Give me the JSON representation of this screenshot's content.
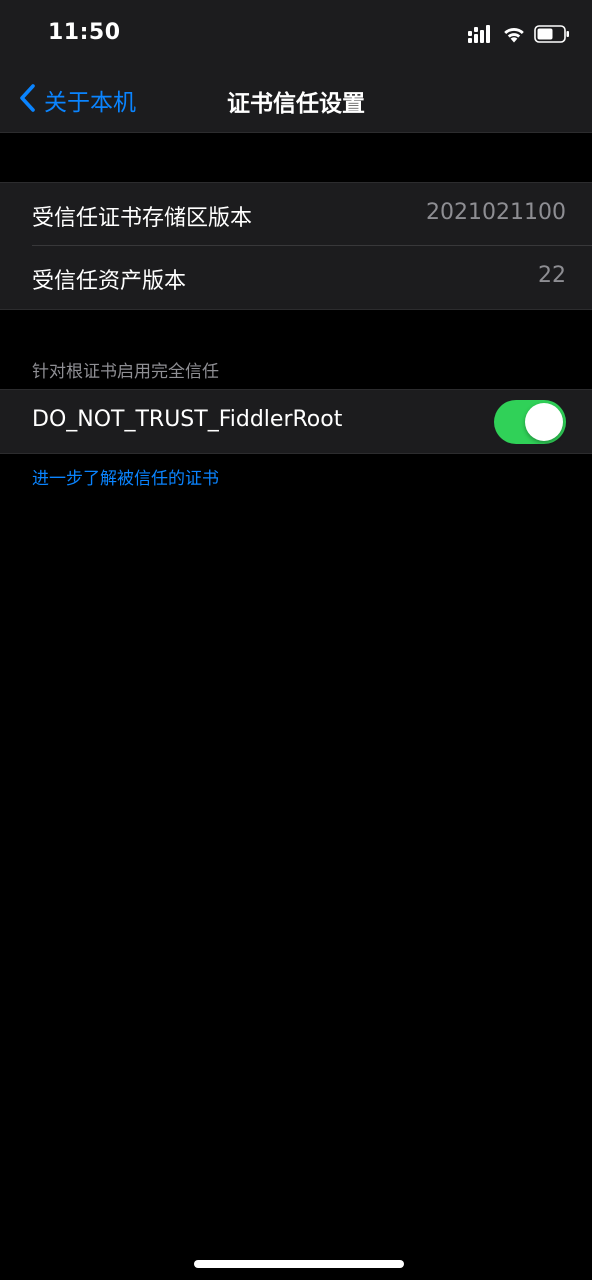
{
  "status_bar": {
    "time": "11:50",
    "icons": [
      "cellular-signal-icon",
      "wifi-icon",
      "battery-icon"
    ]
  },
  "nav": {
    "back_label": "关于本机",
    "title": "证书信任设置"
  },
  "versions": [
    {
      "label": "受信任证书存储区版本",
      "value": "2021021100"
    },
    {
      "label": "受信任资产版本",
      "value": "22"
    }
  ],
  "trust_section": {
    "header": "针对根证书启用完全信任",
    "certificates": [
      {
        "name": "DO_NOT_TRUST_FiddlerRoot",
        "enabled": true
      }
    ],
    "learn_more_link": "进一步了解被信任的证书"
  },
  "colors": {
    "accent": "#0a84ff",
    "toggle_on": "#30d158",
    "background": "#000000",
    "cell_background": "#1c1c1e",
    "secondary_text": "#8e8e93"
  }
}
